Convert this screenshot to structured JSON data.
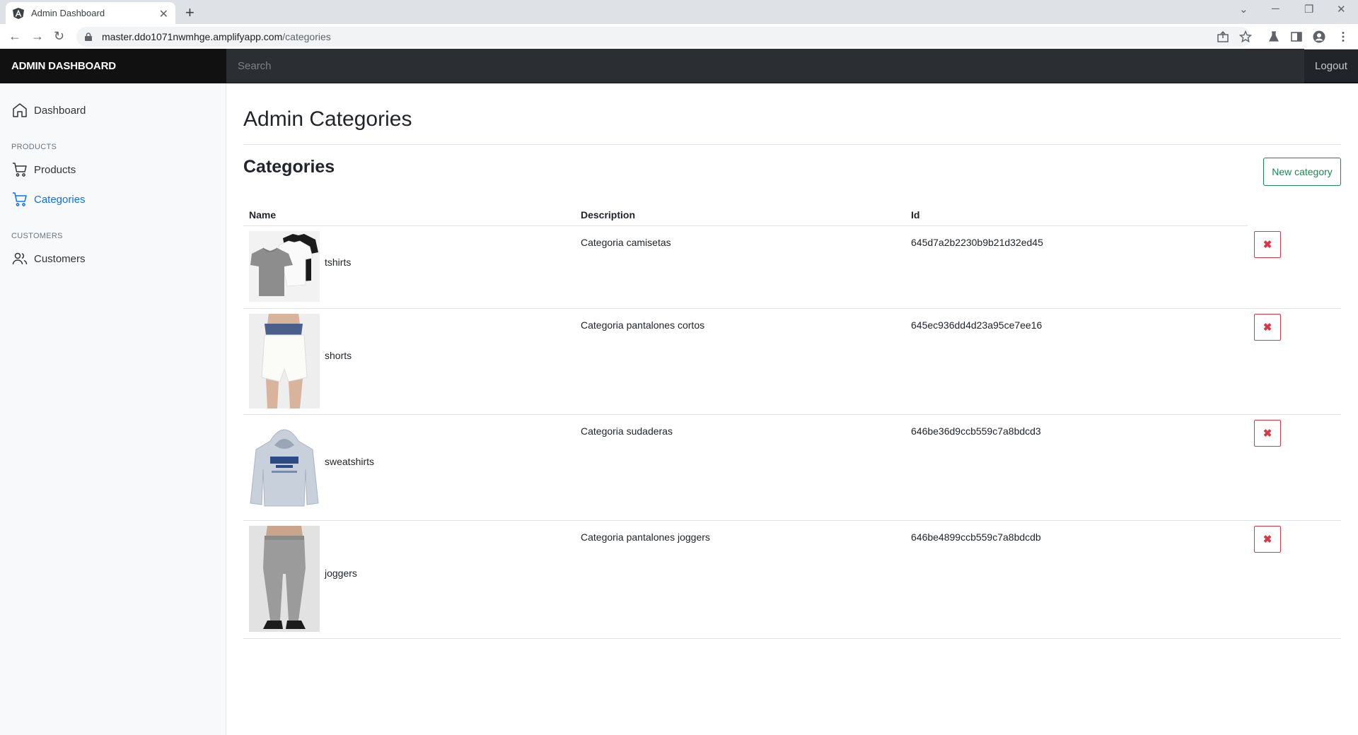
{
  "browser": {
    "tab_title": "Admin Dashboard",
    "url_host": "master.ddo1071nwmhge.amplifyapp.com",
    "url_path": "/categories"
  },
  "header": {
    "brand": "ADMIN DASHBOARD",
    "search_placeholder": "Search",
    "logout": "Logout"
  },
  "sidebar": {
    "dashboard": "Dashboard",
    "products_section": "PRODUCTS",
    "products": "Products",
    "categories": "Categories",
    "customers_section": "CUSTOMERS",
    "customers": "Customers"
  },
  "main": {
    "title": "Admin Categories",
    "subtitle": "Categories",
    "new_button": "New category",
    "columns": {
      "name": "Name",
      "description": "Description",
      "id": "Id"
    },
    "rows": [
      {
        "name": "tshirts",
        "description": "Categoria camisetas",
        "id": "645d7a2b2230b9b21d32ed45"
      },
      {
        "name": "shorts",
        "description": "Categoria pantalones cortos",
        "id": "645ec936dd4d23a95ce7ee16"
      },
      {
        "name": "sweatshirts",
        "description": "Categoria sudaderas",
        "id": "646be36d9ccb559c7a8bdcd3"
      },
      {
        "name": "joggers",
        "description": "Categoria pantalones joggers",
        "id": "646be4899ccb559c7a8bdcdb"
      }
    ],
    "delete_glyph": "✖"
  },
  "colors": {
    "accent": "#0d6efd",
    "success": "#198754",
    "danger": "#dc3545",
    "header_bg": "#212529"
  }
}
